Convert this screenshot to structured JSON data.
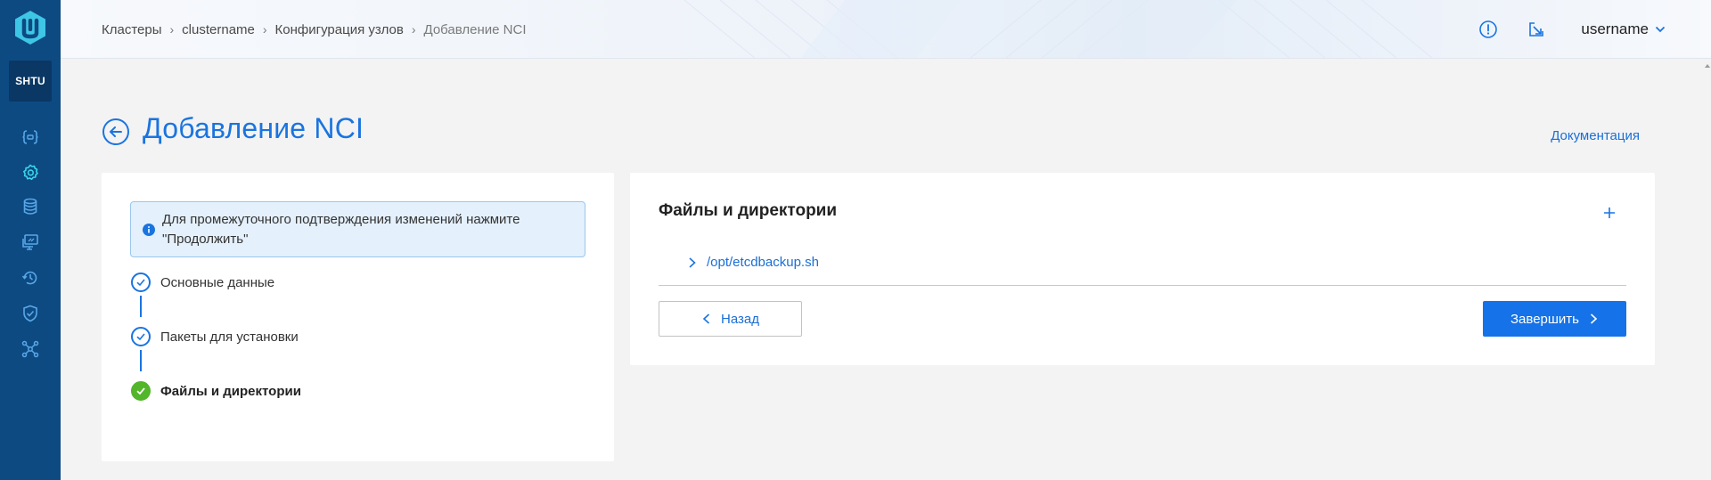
{
  "sidebar": {
    "logo_icon": "product-logo",
    "cluster_badge": "SHTU",
    "items": [
      {
        "icon": "braces-icon",
        "active": false
      },
      {
        "icon": "gear-icon",
        "active": true
      },
      {
        "icon": "database-icon",
        "active": false
      },
      {
        "icon": "monitor-icon",
        "active": false
      },
      {
        "icon": "backup-restore-icon",
        "active": false
      },
      {
        "icon": "shield-check-icon",
        "active": false
      },
      {
        "icon": "network-nodes-icon",
        "active": false
      }
    ]
  },
  "header": {
    "breadcrumb": [
      "Кластеры",
      "clustername",
      "Конфигурация узлов",
      "Добавление NCI"
    ],
    "alert_icon": "alert-circle-icon",
    "external_icon": "open-window-icon",
    "username": "username"
  },
  "page": {
    "title": "Добавление NCI",
    "doc_link": "Документация"
  },
  "steps_panel": {
    "info_text": "Для промежуточного подтверждения изменений нажмите \"Продолжить\"",
    "steps": [
      {
        "label": "Основные данные",
        "status": "completed"
      },
      {
        "label": "Пакеты для установки",
        "status": "completed"
      },
      {
        "label": "Файлы и директории",
        "status": "current"
      }
    ]
  },
  "files_panel": {
    "title": "Файлы и директории",
    "files": [
      "/opt/etcdbackup.sh"
    ],
    "back_label": "Назад",
    "finish_label": "Завершить"
  },
  "colors": {
    "sidebar": "#0d4a82",
    "accent": "#1a74e0",
    "primary_button": "#1572e8",
    "success": "#52b52a",
    "info_bg": "#e4f0fc",
    "active_nav": "#3ad6e8"
  }
}
